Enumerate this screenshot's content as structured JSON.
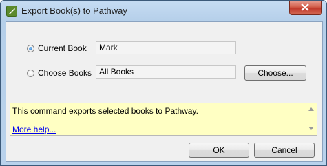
{
  "window": {
    "title": "Export Book(s) to Pathway",
    "close_icon": "close-icon"
  },
  "options": {
    "current_book": {
      "label": "Current Book",
      "checked": true,
      "value": "Mark"
    },
    "choose_books": {
      "label": "Choose Books",
      "checked": false,
      "value": "All Books",
      "button_label": "Choose..."
    }
  },
  "info": {
    "text": "This command exports selected books to Pathway.",
    "help_link": "More help..."
  },
  "buttons": {
    "ok_rest": "K",
    "ok_accel": "O",
    "cancel_accel": "C",
    "cancel_rest": "ancel"
  }
}
